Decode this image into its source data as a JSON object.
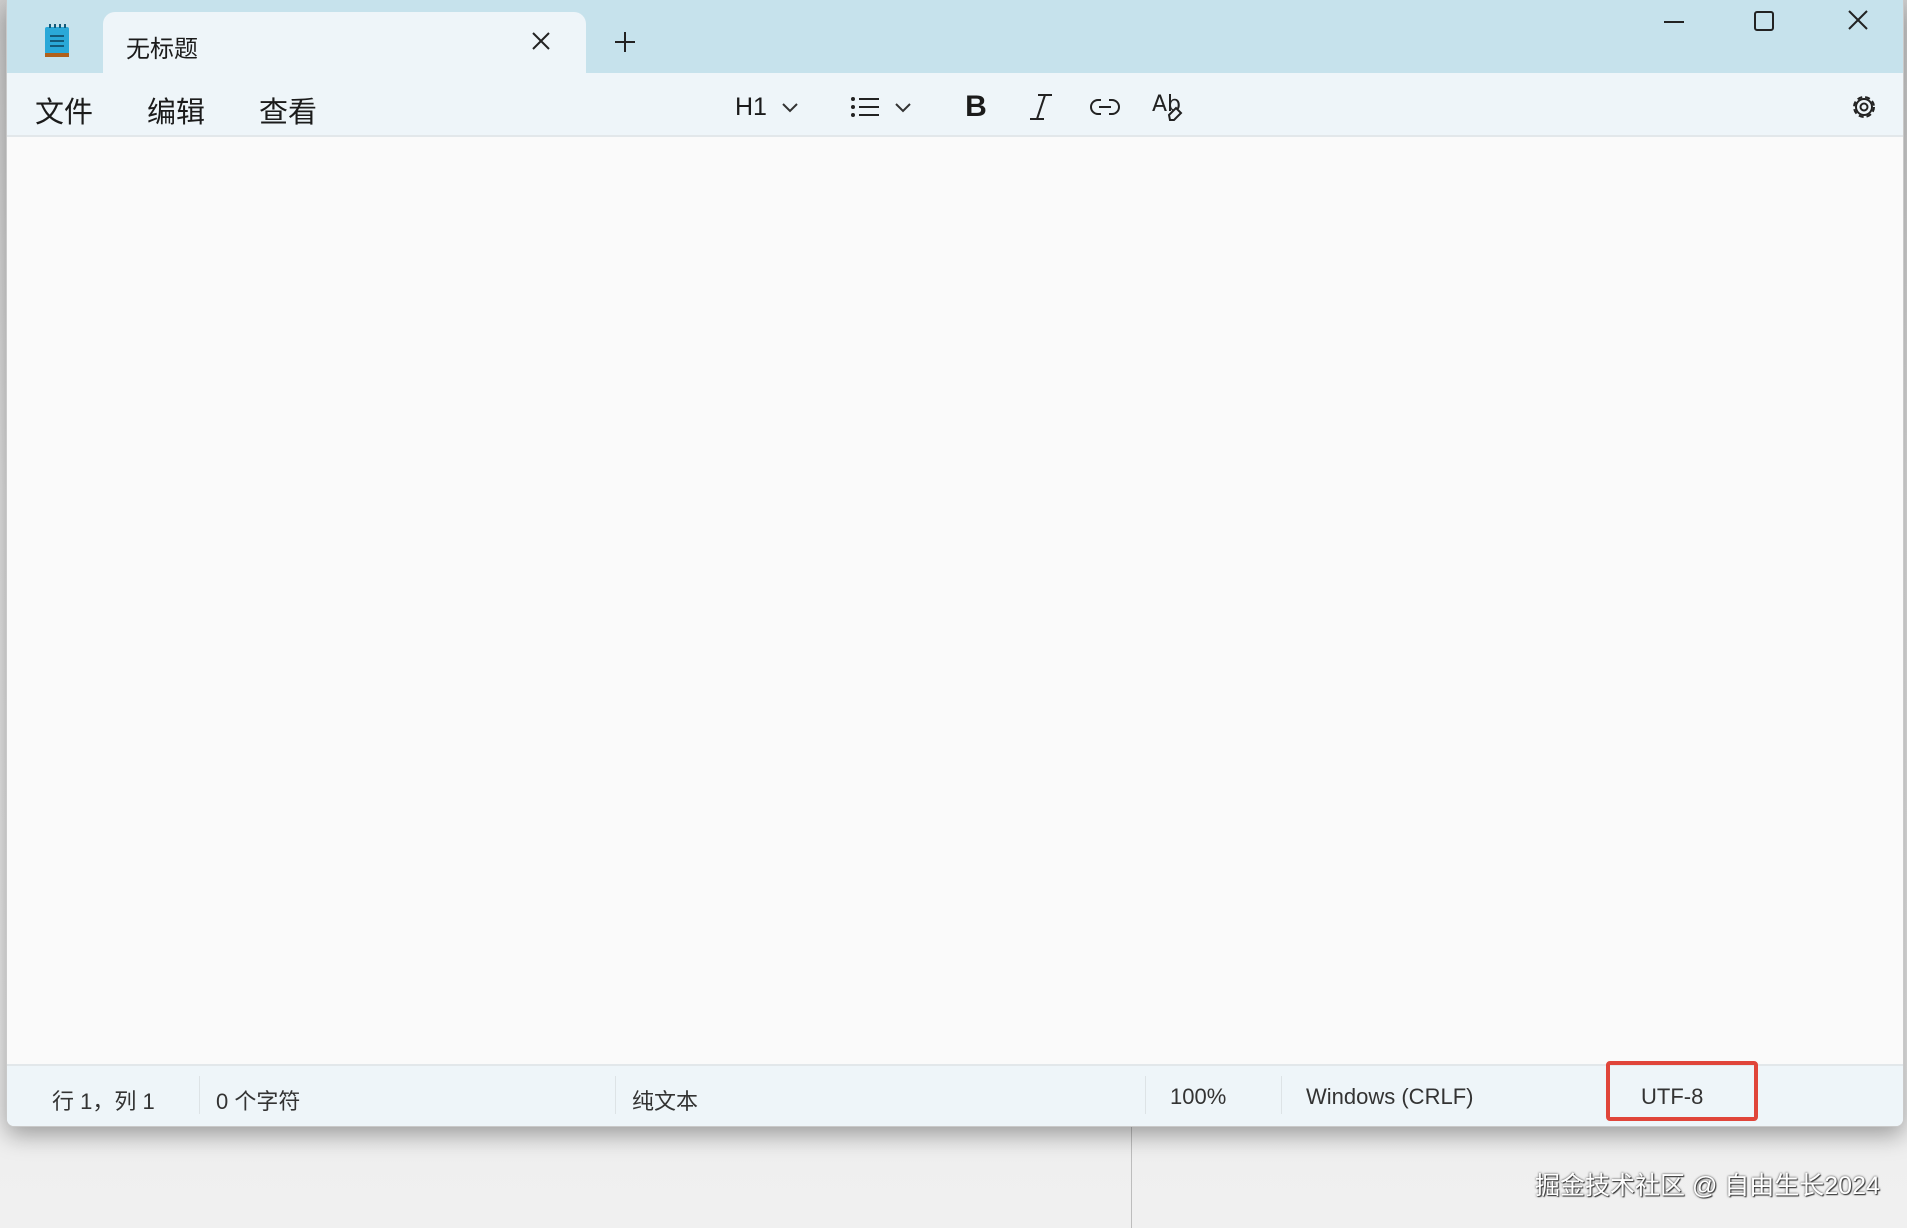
{
  "tab": {
    "title": "无标题"
  },
  "menu": {
    "file": "文件",
    "edit": "编辑",
    "view": "查看"
  },
  "toolbar": {
    "heading": "H1"
  },
  "status": {
    "position": "行 1，列 1",
    "chars": "0 个字符",
    "format": "纯文本",
    "zoom": "100%",
    "line_ending": "Windows (CRLF)",
    "encoding": "UTF-8"
  },
  "watermark": "掘金技术社区 @ 自由生长2024",
  "colors": {
    "highlight": "#e0453a",
    "titlebar": "#c6e2ec"
  }
}
